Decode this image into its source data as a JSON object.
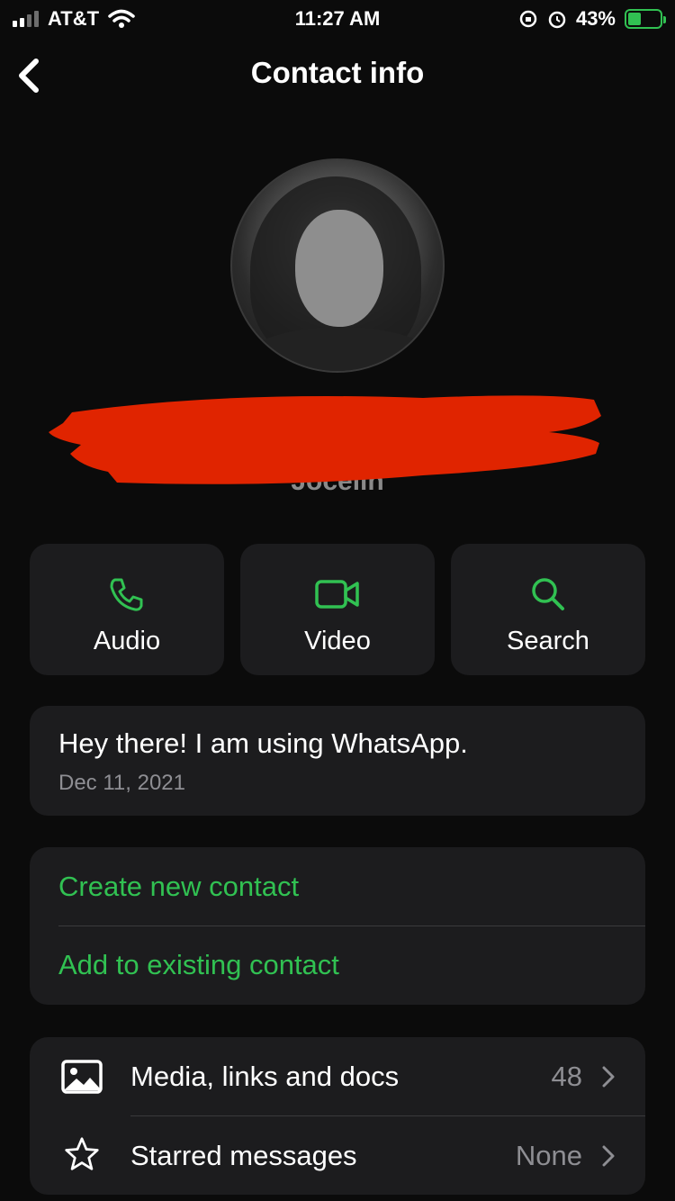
{
  "status": {
    "carrier": "AT&T",
    "time": "11:27 AM",
    "battery": "43%"
  },
  "header": {
    "title": "Contact info"
  },
  "contact": {
    "secondary_name": "Jocelin"
  },
  "actions": [
    {
      "label": "Audio",
      "icon": "phone-icon"
    },
    {
      "label": "Video",
      "icon": "video-icon"
    },
    {
      "label": "Search",
      "icon": "search-icon"
    }
  ],
  "about": {
    "text": "Hey there! I am using WhatsApp.",
    "date": "Dec 11, 2021"
  },
  "contact_actions": {
    "create": "Create new contact",
    "add_existing": "Add to existing contact"
  },
  "rows": [
    {
      "label": "Media, links and docs",
      "value": "48",
      "icon": "image-icon"
    },
    {
      "label": "Starred messages",
      "value": "None",
      "icon": "star-icon"
    }
  ],
  "colors": {
    "accent": "#31c152",
    "background": "#0b0b0b",
    "card": "#1c1c1e",
    "redaction": "#e02400"
  }
}
